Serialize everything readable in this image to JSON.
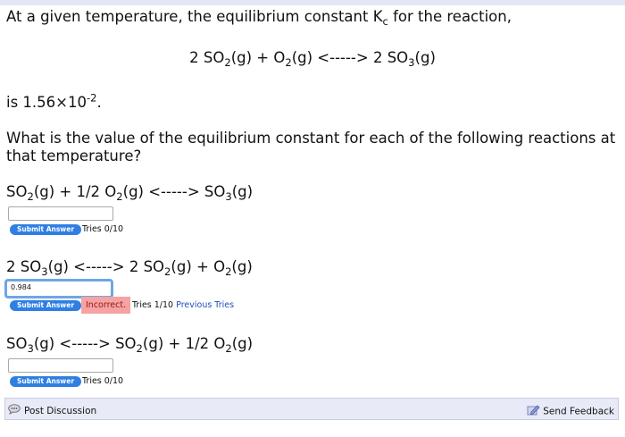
{
  "intro": {
    "line1_pre": "At a given temperature, the equilibrium constant K",
    "line1_sub": "c",
    "line1_post": " for the reaction,"
  },
  "main_reaction": {
    "a": "2 SO",
    "a_sub": "2",
    "b": "(g) + O",
    "b_sub": "2",
    "c": "(g) <-----> 2 SO",
    "c_sub": "3",
    "d": "(g)"
  },
  "kc_value": {
    "pre": "is 1.56×10",
    "exp": "-2",
    "post": "."
  },
  "question": {
    "line1": "What is the value of the equilibrium constant for each of the following reactions at",
    "line2": "that temperature?"
  },
  "parts": [
    {
      "eq": {
        "a": "SO",
        "a_sub": "2",
        "b": "(g) + 1/2 O",
        "b_sub": "2",
        "c": "(g) <-----> SO",
        "c_sub": "3",
        "d": "(g)"
      },
      "input_value": "",
      "submit_label": "Submit Answer",
      "tries": "Tries 0/10"
    },
    {
      "eq": {
        "a": "2 SO",
        "a_sub": "3",
        "b": "(g) <-----> 2 SO",
        "b_sub": "2",
        "c": "(g) + O",
        "c_sub": "2",
        "d": "(g)"
      },
      "input_value": "0.984",
      "submit_label": "Submit Answer",
      "feedback": "Incorrect.",
      "tries": "Tries 1/10",
      "previous_tries": "Previous Tries"
    },
    {
      "eq": {
        "a": "SO",
        "a_sub": "3",
        "b": "(g) <-----> SO",
        "b_sub": "2",
        "c": "(g) + 1/2 O",
        "c_sub": "2",
        "d": "(g)"
      },
      "input_value": "",
      "submit_label": "Submit Answer",
      "tries": "Tries 0/10"
    }
  ],
  "footer": {
    "post_discussion": "Post Discussion",
    "send_feedback": "Send Feedback",
    "post_icon": "discussion-bubble-icon",
    "feedback_icon": "pencil-paper-icon"
  },
  "colors": {
    "submit_button": "#2f7fe3",
    "incorrect_bg": "#f6a3a3",
    "focus_ring": "#6ea6e6",
    "footer_bg": "#e8eaf8"
  }
}
